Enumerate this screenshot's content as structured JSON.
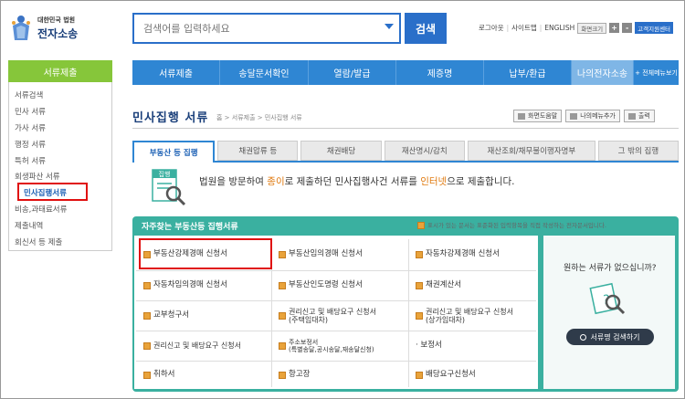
{
  "header": {
    "logo_line1": "대한민국 법원",
    "logo_line2": "전자소송",
    "search_placeholder": "검색어를 입력하세요",
    "search_button": "검색",
    "util": {
      "logout": "로그아웃",
      "sitemap": "사이트맵",
      "english": "ENGLISH",
      "font_size": "화면크기",
      "plus": "+",
      "minus": "-",
      "helpdesk": "고객지원센터"
    }
  },
  "nav": {
    "items": [
      {
        "label": "서류제출",
        "active": false
      },
      {
        "label": "송달문서확인",
        "active": false
      },
      {
        "label": "열람/발급",
        "active": false
      },
      {
        "label": "제증명",
        "active": false
      },
      {
        "label": "납부/환급",
        "active": false
      },
      {
        "label": "나의전자소송",
        "active": true
      }
    ],
    "all_menu": "+ 전체메뉴보기"
  },
  "sidebar": {
    "title": "서류제출",
    "items": [
      {
        "label": "서류검색",
        "active": false
      },
      {
        "label": "민사 서류",
        "active": false
      },
      {
        "label": "가사 서류",
        "active": false
      },
      {
        "label": "행정 서류",
        "active": false
      },
      {
        "label": "특허 서류",
        "active": false
      },
      {
        "label": "회생파산 서류",
        "active": false
      },
      {
        "label": "민사집행서류",
        "active": true
      },
      {
        "label": "비송,과태료서류",
        "active": false
      },
      {
        "label": "제출내역",
        "active": false
      },
      {
        "label": "회신서 등 제출",
        "active": false
      }
    ]
  },
  "content": {
    "title": "민사집행 서류",
    "breadcrumb": "홈 > 서류제출 > 민사집행 서류",
    "tools": [
      "화면도움말",
      "나의메뉴추가",
      "출력"
    ],
    "tabs": [
      {
        "label": "부동산 등 집행",
        "active": true
      },
      {
        "label": "채권압류 등",
        "active": false
      },
      {
        "label": "채권배당",
        "active": false
      },
      {
        "label": "재산명시/감치",
        "active": false
      },
      {
        "label": "재산조회/채무불이행자명부",
        "active": false
      },
      {
        "label": "그 밖의 집행",
        "active": false
      }
    ],
    "info_icon_label": "집행",
    "info": {
      "p1": "법원을 방문하여 ",
      "h1": "종이",
      "p2": "로 제출하던 민사집행사건 서류를 ",
      "h2": "인터넷",
      "p3": "으로 제출합니다."
    }
  },
  "panel": {
    "title": "자주찾는 부동산등 집행서류",
    "note": "표시가 있는 문서는 표준화된 입력항목을 직접 작성하는 전자문서입니다.",
    "cells": [
      {
        "label": "부동산강제경매 신청서",
        "marked": true
      },
      {
        "label": "부동산임의경매 신청서",
        "marked": true
      },
      {
        "label": "자동차강제경매 신청서",
        "marked": true
      },
      {
        "label": "자동차임의경매 신청서",
        "marked": true
      },
      {
        "label": "부동산인도명령 신청서",
        "marked": true
      },
      {
        "label": "채권계산서",
        "marked": true
      },
      {
        "label": "교부청구서",
        "marked": true
      },
      {
        "label": "권리신고 및 배당요구 신청서\n(주택임대차)",
        "marked": true
      },
      {
        "label": "권리신고 및 배당요구 신청서\n(상가임대차)",
        "marked": true
      },
      {
        "label": "권리신고 및 배당요구 신청서",
        "marked": true
      },
      {
        "label": "주소보정서\n(특별송달,공시송달,재송달신청)",
        "marked": true
      },
      {
        "label": "· 보정서",
        "marked": false
      },
      {
        "label": "취하서",
        "marked": true
      },
      {
        "label": "항고장",
        "marked": true
      },
      {
        "label": "배당요구신청서",
        "marked": true
      }
    ],
    "right_question": "원하는 서류가 없으십니까?",
    "right_button": "서류명 검색하기"
  },
  "colors": {
    "accent": "#2f86d3",
    "sidebar_header": "#86c63a",
    "panel": "#3ab0a0",
    "highlight": "#e01010"
  }
}
